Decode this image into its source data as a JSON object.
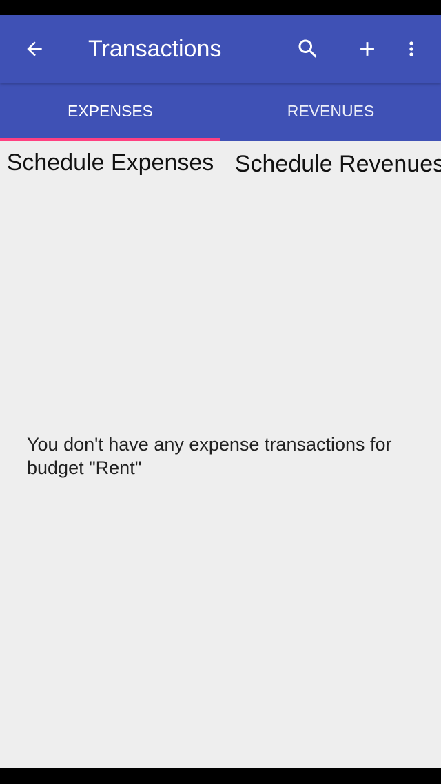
{
  "app_bar": {
    "title": "Transactions",
    "background": "#3f51b5",
    "icons": [
      "arrow-back-icon",
      "search-icon",
      "add-icon",
      "more-vert-icon"
    ]
  },
  "tabs": [
    {
      "label": "EXPENSES",
      "selected": true
    },
    {
      "label": "REVENUES",
      "selected": false
    }
  ],
  "tab_indicator_color": "#ff4081",
  "schedule": {
    "expenses_label": "Schedule Expenses",
    "revenues_label": "Schedule Revenues"
  },
  "empty_message": "You don't have any expense transactions for budget \"Rent\""
}
